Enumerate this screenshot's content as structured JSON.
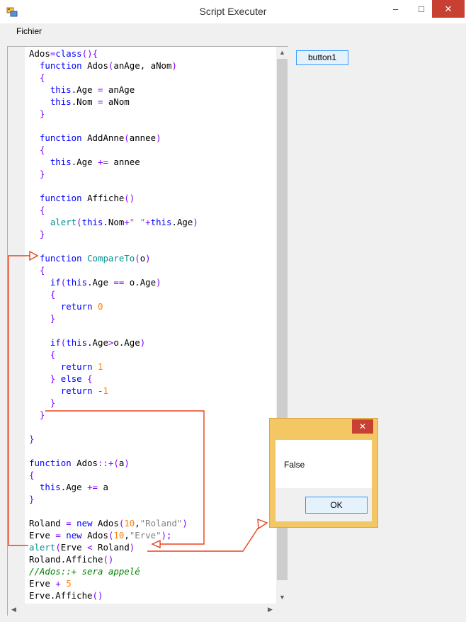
{
  "window": {
    "title": "Script Executer",
    "minimize": "–",
    "maximize": "□",
    "close": "✕"
  },
  "menu": {
    "items": [
      {
        "label": "Fichier"
      }
    ]
  },
  "button1": {
    "label": "button1"
  },
  "editor": {
    "lines": [
      "Ados=class(){",
      "  function Ados(anAge, aNom)",
      "  {",
      "    this.Age = anAge",
      "    this.Nom = aNom",
      "  }",
      "",
      "  function AddAnne(annee)",
      "  {",
      "    this.Age += annee",
      "  }",
      "",
      "  function Affiche()",
      "  {",
      "    alert(this.Nom+\" \"+this.Age)",
      "  }",
      "",
      "  function CompareTo(o)",
      "  {",
      "    if(this.Age == o.Age)",
      "    {",
      "      return 0",
      "    }",
      "",
      "    if(this.Age>o.Age)",
      "    {",
      "      return 1",
      "    } else {",
      "      return -1",
      "    }",
      "  }",
      "",
      "}",
      "",
      "function Ados::+(a)",
      "{",
      "  this.Age += a",
      "}",
      "",
      "Roland = new Ados(10,\"Roland\")",
      "Erve = new Ados(10,\"Erve\");",
      "alert(Erve < Roland)",
      "Roland.Affiche()",
      "//Ados::+ sera appelé",
      "Erve + 5",
      "Erve.Affiche()"
    ]
  },
  "dialog": {
    "message": "False",
    "ok": "OK",
    "close": "✕"
  },
  "colors": {
    "keyword": "#0000ff",
    "function_name": "#009090",
    "number": "#ff8000",
    "string": "#808080",
    "comment": "#008000",
    "brace": "#8000ff",
    "annotation": "#e8401c",
    "dialog_frame": "#f2c764",
    "close_button": "#c84031"
  }
}
